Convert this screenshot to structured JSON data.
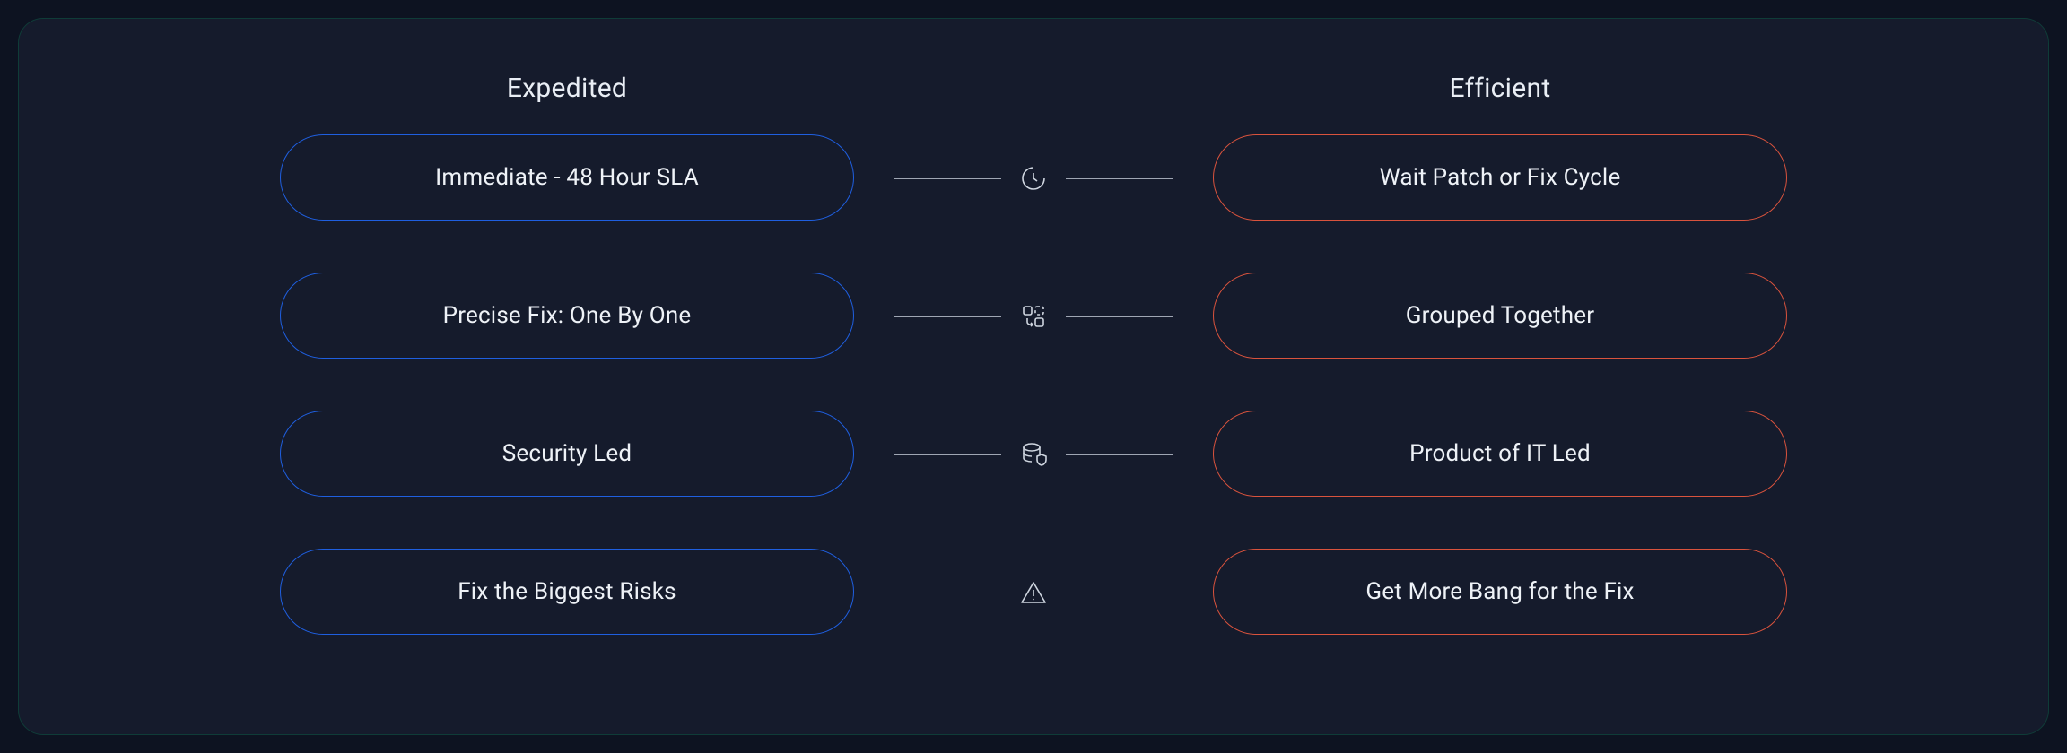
{
  "colors": {
    "blue": "#1f5fe0",
    "red": "#d9533d",
    "bg": "#151b2c"
  },
  "left": {
    "title": "Expedited",
    "items": [
      "Immediate - 48 Hour SLA",
      "Precise Fix: One By One",
      "Security Led",
      "Fix the Biggest Risks"
    ]
  },
  "right": {
    "title": "Efficient",
    "items": [
      "Wait Patch or Fix Cycle",
      "Grouped Together",
      "Product of IT Led",
      "Get More Bang for the Fix"
    ]
  },
  "connectors": [
    {
      "icon": "clock-icon"
    },
    {
      "icon": "group-icon"
    },
    {
      "icon": "database-shield-icon"
    },
    {
      "icon": "warning-icon"
    }
  ]
}
